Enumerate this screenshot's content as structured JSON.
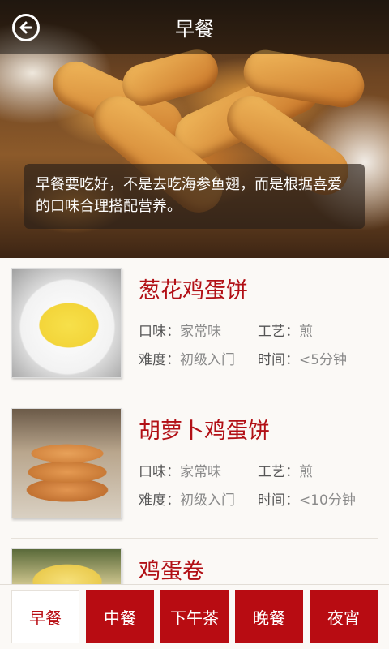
{
  "header": {
    "title": "早餐",
    "back_icon": "back-arrow-icon"
  },
  "hero": {
    "caption": "早餐要吃好，不是去吃海参鱼翅，而是根据喜爱的口味合理搭配营养。"
  },
  "labels": {
    "taste": "口味：",
    "craft": "工艺：",
    "difficulty": "难度：",
    "time": "时间："
  },
  "recipes": [
    {
      "name": "葱花鸡蛋饼",
      "taste": "家常味",
      "craft": "煎",
      "difficulty": "初级入门",
      "time": "<5分钟"
    },
    {
      "name": "胡萝卜鸡蛋饼",
      "taste": "家常味",
      "craft": "煎",
      "difficulty": "初级入门",
      "time": "<10分钟"
    },
    {
      "name": "鸡蛋卷"
    }
  ],
  "tabs": [
    {
      "label": "早餐",
      "active": true
    },
    {
      "label": "中餐"
    },
    {
      "label": "下午茶"
    },
    {
      "label": "晚餐"
    },
    {
      "label": "夜宵"
    }
  ],
  "colors": {
    "accent": "#b80c12",
    "title_red": "#b21016"
  }
}
